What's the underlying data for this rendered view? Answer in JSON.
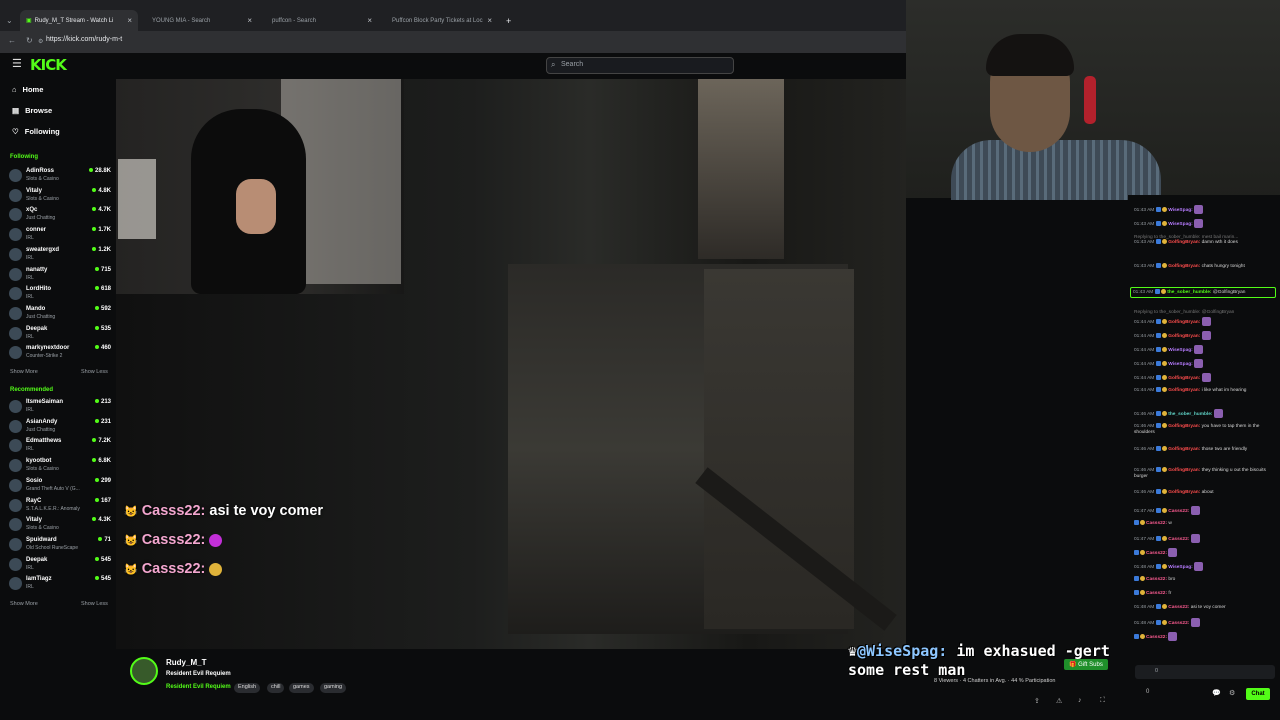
{
  "browser": {
    "tabs": [
      {
        "label": "Rudy_M_T Stream - Watch Li",
        "active": true
      },
      {
        "label": "YOUNG MIA - Search",
        "active": false
      },
      {
        "label": "puffcon - Search",
        "active": false
      },
      {
        "label": "Puffcon Block Party Tickets at Loc",
        "active": false
      }
    ],
    "new_tab": "+",
    "url": "https://kick.com/rudy-m-t"
  },
  "header": {
    "logo": "KICK",
    "search_placeholder": "Search"
  },
  "sidebar": {
    "nav": [
      {
        "label": "Home",
        "icon": "home-icon"
      },
      {
        "label": "Browse",
        "icon": "browse-icon"
      },
      {
        "label": "Following",
        "icon": "heart-icon"
      }
    ],
    "following_title": "Following",
    "following": [
      {
        "name": "AdinRoss",
        "category": "Slots & Casino",
        "viewers": "28.8K"
      },
      {
        "name": "Vitaly",
        "category": "Slots & Casino",
        "viewers": "4.8K"
      },
      {
        "name": "xQc",
        "category": "Just Chatting",
        "viewers": "4.7K"
      },
      {
        "name": "conner",
        "category": "IRL",
        "viewers": "1.7K"
      },
      {
        "name": "sweatergxd",
        "category": "IRL",
        "viewers": "1.2K"
      },
      {
        "name": "nanatty",
        "category": "IRL",
        "viewers": "715"
      },
      {
        "name": "LordHito",
        "category": "IRL",
        "viewers": "618"
      },
      {
        "name": "Mando",
        "category": "Just Chatting",
        "viewers": "592"
      },
      {
        "name": "Deepak",
        "category": "IRL",
        "viewers": "535"
      },
      {
        "name": "markynextdoor",
        "category": "Counter-Strike 2",
        "viewers": "460"
      }
    ],
    "show_more": "Show More",
    "show_less": "Show Less",
    "recommended_title": "Recommended",
    "recommended": [
      {
        "name": "ItsmeSaiman",
        "category": "IRL",
        "viewers": "213"
      },
      {
        "name": "AsianAndy",
        "category": "Just Chatting",
        "viewers": "231"
      },
      {
        "name": "Edmatthews",
        "category": "IRL",
        "viewers": "7.2K"
      },
      {
        "name": "kyootbot",
        "category": "Slots & Casino",
        "viewers": "6.8K"
      },
      {
        "name": "Sosio",
        "category": "Grand Theft Auto V (G...",
        "viewers": "299"
      },
      {
        "name": "RayC",
        "category": "S.T.A.L.K.E.R.: Anomaly",
        "viewers": "167"
      },
      {
        "name": "Vitaly",
        "category": "Slots & Casino",
        "viewers": "4.3K"
      },
      {
        "name": "Spuidward",
        "category": "Old School RuneScape",
        "viewers": "71"
      },
      {
        "name": "Deepak",
        "category": "IRL",
        "viewers": "545"
      },
      {
        "name": "IamTiagz",
        "category": "IRL",
        "viewers": "545"
      }
    ]
  },
  "overlay_chat": [
    {
      "user": "Casss22:",
      "text": "asi te voy comer"
    },
    {
      "user": "Casss22:",
      "text": ""
    },
    {
      "user": "Casss22:",
      "text": ""
    }
  ],
  "big_overlay": {
    "user": "@WiseSpag:",
    "text": "im exhasued -gert",
    "text2": "some rest man"
  },
  "chat": [
    {
      "time": "01:43 AM",
      "user": "WiseSpag:",
      "color": "#b77cff",
      "text": ""
    },
    {
      "time": "01:43 AM",
      "user": "WiseSpag:",
      "color": "#b77cff",
      "text": ""
    },
    {
      "time": "01:43 AM",
      "user": "GolfingBryan:",
      "color": "#ff4d4d",
      "text": "damn wth it does"
    },
    {
      "time": "01:43 AM",
      "user": "GolfingBryan:",
      "color": "#ff4d4d",
      "text": "chats hungry tonight"
    },
    {
      "time": "01:43 AM",
      "user": "the_sober_humble:",
      "color": "#53fc18",
      "text": "@GolfingBryan"
    },
    {
      "time": "01:44 AM",
      "user": "GolfingBryan:",
      "color": "#ff4d4d",
      "text": ""
    },
    {
      "time": "01:44 AM",
      "user": "GolfingBryan:",
      "color": "#ff4d4d",
      "text": ""
    },
    {
      "time": "01:44 AM",
      "user": "WiseSpag:",
      "color": "#b77cff",
      "text": ""
    },
    {
      "time": "01:44 AM",
      "user": "WiseSpag:",
      "color": "#b77cff",
      "text": ""
    },
    {
      "time": "01:44 AM",
      "user": "GolfingBryan:",
      "color": "#ff4d4d",
      "text": ""
    },
    {
      "time": "01:44 AM",
      "user": "GolfingBryan:",
      "color": "#ff4d4d",
      "text": "i like what im hearing"
    },
    {
      "time": "01:46 AM",
      "user": "the_sober_humble:",
      "color": "#5fd3c6",
      "text": ""
    },
    {
      "time": "01:46 AM",
      "user": "GolfingBryan:",
      "color": "#ff4d4d",
      "text": "you have to tap them in the shoulders"
    },
    {
      "time": "01:46 AM",
      "user": "GolfingBryan:",
      "color": "#ff4d4d",
      "text": "those two are friendly"
    },
    {
      "time": "01:46 AM",
      "user": "GolfingBryan:",
      "color": "#ff4d4d",
      "text": "they thinking u out the biscuits burger"
    },
    {
      "time": "01:46 AM",
      "user": "GolfingBryan:",
      "color": "#ff4d4d",
      "text": "about"
    },
    {
      "time": "01:47 AM",
      "user": "Casss22:",
      "color": "#ff5c93",
      "text": ""
    },
    {
      "time": "",
      "user": "Casss22:",
      "color": "#ff5c93",
      "text": "w"
    },
    {
      "time": "01:47 AM",
      "user": "Casss22:",
      "color": "#ff5c93",
      "text": ""
    },
    {
      "time": "",
      "user": "Casss22:",
      "color": "#ff5c93",
      "text": ""
    },
    {
      "time": "01:48 AM",
      "user": "WiseSpag:",
      "color": "#b77cff",
      "text": ""
    },
    {
      "time": "",
      "user": "Casss22:",
      "color": "#ff5c93",
      "text": "bro"
    },
    {
      "time": "",
      "user": "Casss22:",
      "color": "#ff5c93",
      "text": "fr"
    },
    {
      "time": "01:48 AM",
      "user": "Casss22:",
      "color": "#ff5c93",
      "text": "asi te voy comer"
    },
    {
      "time": "01:48 AM",
      "user": "Casss22:",
      "color": "#ff5c93",
      "text": ""
    },
    {
      "time": "",
      "user": "Casss22:",
      "color": "#ff5c93",
      "text": ""
    }
  ],
  "reply_notes": [
    "Replying to the_sober_humble: mest bail marin...",
    "Replying to the_sober_humble: @GolfingBryan"
  ],
  "stream": {
    "channel": "Rudy_M_T",
    "title": "Resident Evil Requiem",
    "category": "Resident Evil Requiem",
    "tags": [
      "English",
      "chill",
      "games",
      "gaming"
    ]
  },
  "stats": {
    "viewers": "8 Viewers",
    "chatters": "4 Chatters in Avg.",
    "participation": "44 % Participation"
  },
  "gift_subs": "Gift Subs",
  "chat_button": "Chat",
  "chat_count": "0",
  "chat_count2": "0",
  "colors": {
    "accent": "#53fc18",
    "bg": "#0b0c0d"
  }
}
